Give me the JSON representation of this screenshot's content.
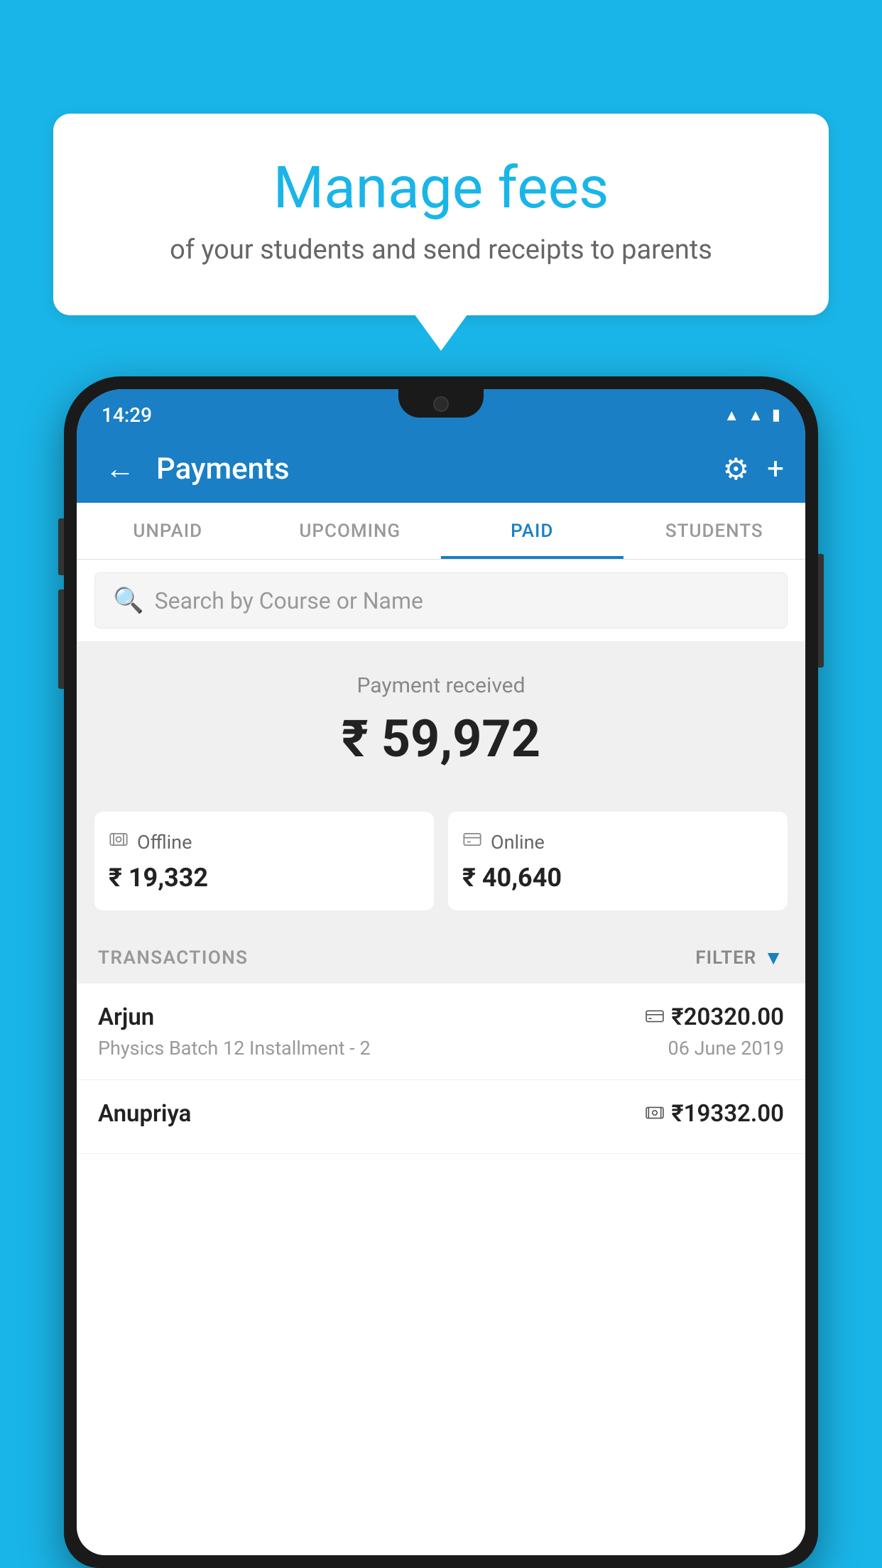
{
  "background_color": "#1ab5e8",
  "tooltip": {
    "title": "Manage fees",
    "subtitle": "of your students and send receipts to parents"
  },
  "status_bar": {
    "time": "14:29",
    "icons": [
      "wifi",
      "signal",
      "battery"
    ]
  },
  "app_bar": {
    "title": "Payments",
    "back_label": "←",
    "gear_label": "⚙",
    "plus_label": "+"
  },
  "tabs": [
    {
      "label": "UNPAID",
      "active": false
    },
    {
      "label": "UPCOMING",
      "active": false
    },
    {
      "label": "PAID",
      "active": true
    },
    {
      "label": "STUDENTS",
      "active": false
    }
  ],
  "search": {
    "placeholder": "Search by Course or Name"
  },
  "payment_summary": {
    "label": "Payment received",
    "amount": "₹ 59,972",
    "offline": {
      "icon": "💳",
      "label": "Offline",
      "amount": "₹ 19,332"
    },
    "online": {
      "icon": "💳",
      "label": "Online",
      "amount": "₹ 40,640"
    }
  },
  "transactions": {
    "header": "TRANSACTIONS",
    "filter_label": "FILTER",
    "rows": [
      {
        "name": "Arjun",
        "detail": "Physics Batch 12 Installment - 2",
        "amount": "₹20320.00",
        "date": "06 June 2019",
        "payment_type": "card"
      },
      {
        "name": "Anupriya",
        "detail": "",
        "amount": "₹19332.00",
        "date": "",
        "payment_type": "cash"
      }
    ]
  }
}
